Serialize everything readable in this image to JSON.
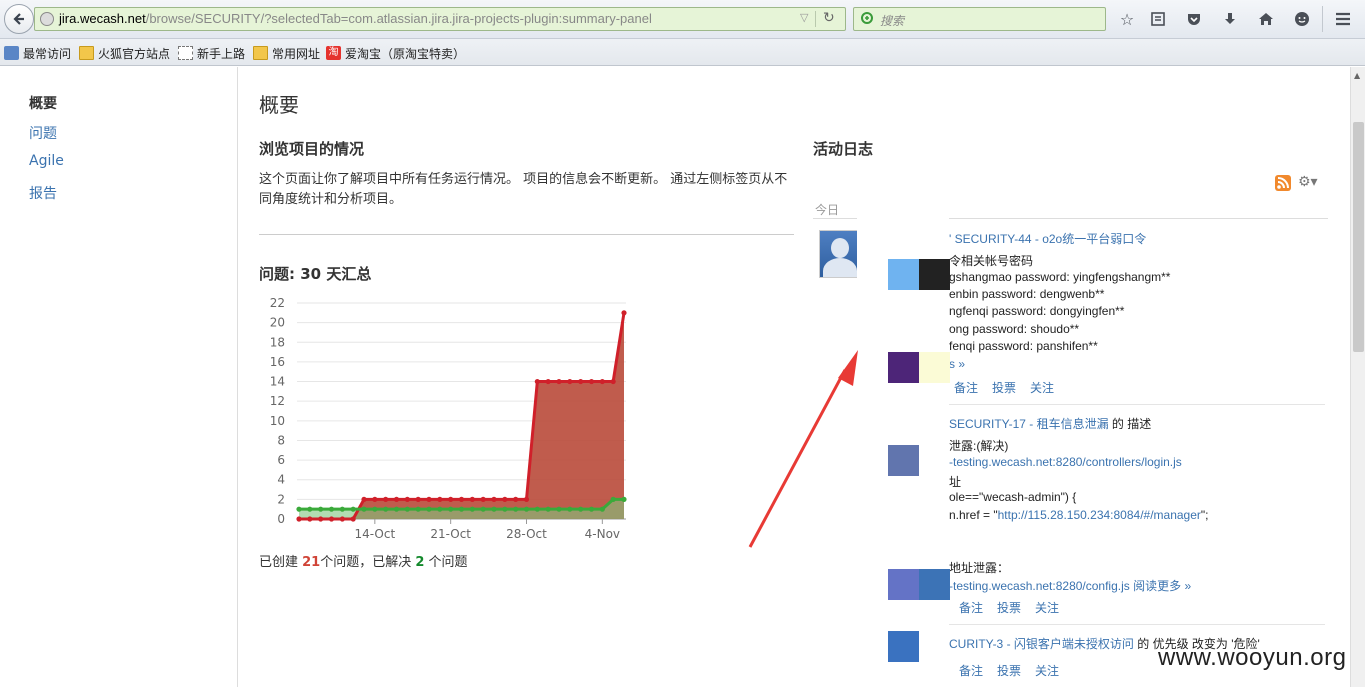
{
  "browser": {
    "url_host": "jira.wecash.net",
    "url_path": "/browse/SECURITY/?selectedTab=com.atlassian.jira.jira-projects-plugin:summary-panel",
    "search_placeholder": "搜索",
    "bookmarks": [
      {
        "label": "最常访问",
        "icon": "gear-icon"
      },
      {
        "label": "火狐官方站点",
        "icon": "folder-icon"
      },
      {
        "label": "新手上路",
        "icon": "page-icon"
      },
      {
        "label": "常用网址",
        "icon": "folder-icon"
      },
      {
        "label": "爱淘宝（原淘宝特卖）",
        "icon": "taobao-icon",
        "icon_text": "淘"
      }
    ]
  },
  "sidebar": {
    "items": [
      {
        "label": "概要",
        "active": true
      },
      {
        "label": "问题",
        "active": false
      },
      {
        "label": "Agile",
        "active": false
      },
      {
        "label": "报告",
        "active": false
      }
    ]
  },
  "main": {
    "title": "概要",
    "overview_title": "浏览项目的情况",
    "overview_desc": "这个页面让你了解项目中所有任务运行情况。 项目的信息会不断更新。 通过左侧标签页从不同角度统计和分析项目。",
    "chart_title": "问题: 30 天汇总",
    "summary": {
      "prefix": "已创建 ",
      "created": "21",
      "mid": "个问题，已解决 ",
      "resolved": "2",
      "suffix": " 个问题"
    }
  },
  "chart_data": {
    "type": "area",
    "title": "问题: 30 天汇总",
    "x_ticks": [
      "14-Oct",
      "21-Oct",
      "28-Oct",
      "4-Nov"
    ],
    "x_tick_index": [
      7,
      14,
      21,
      28
    ],
    "ylim": [
      0,
      22
    ],
    "y_ticks": [
      0,
      2,
      4,
      6,
      8,
      10,
      12,
      14,
      16,
      18,
      20,
      22
    ],
    "grid": true,
    "series": [
      {
        "name": "已创建",
        "color": "#d04437",
        "values": [
          0,
          0,
          0,
          0,
          0,
          0,
          2,
          2,
          2,
          2,
          2,
          2,
          2,
          2,
          2,
          2,
          2,
          2,
          2,
          2,
          2,
          2,
          14,
          14,
          14,
          14,
          14,
          14,
          14,
          14,
          21
        ]
      },
      {
        "name": "已解决",
        "color": "#14892c",
        "values": [
          1,
          1,
          1,
          1,
          1,
          1,
          1,
          1,
          1,
          1,
          1,
          1,
          1,
          1,
          1,
          1,
          1,
          1,
          1,
          1,
          1,
          1,
          1,
          1,
          1,
          1,
          1,
          1,
          1,
          2,
          2
        ]
      }
    ]
  },
  "activity": {
    "title": "活动日志",
    "today_label": "今日",
    "entries": [
      {
        "title": "' SECURITY-44 - o2o统一平台弱口令",
        "lines": [
          "令相关帐号密码",
          "gshangmao password: yingfengshangm**",
          "enbin password: dengwenb**",
          "ngfenqi password: dongyingfen**",
          "ong password: shoudo**",
          "fenqi password: panshifen**"
        ],
        "more": "s »",
        "actions": [
          "备注",
          "投票",
          "关注"
        ]
      },
      {
        "title_link": "SECURITY-17 - 租车信息泄漏",
        "title_suffix": " 的 描述",
        "lines": [
          "泄露:(解决)",
          "-testing.wecash.net:8280/controllers/login.js",
          "址",
          "ole==\"wecash-admin\") {"
        ],
        "href_prefix": "n.href = \"",
        "href_link": "http://115.28.150.234:8084/#/manager",
        "href_suffix": "\";",
        "lines2": [
          "地址泄露：",
          "-testing.wecash.net:8280/config.js"
        ],
        "more": "阅读更多 »",
        "actions": [
          "备注",
          "投票",
          "关注"
        ]
      },
      {
        "title_link": "CURITY-3 - 闪银客户端未授权访问",
        "title_suffix": " 的 优先级 改变为 '危险'",
        "actions": [
          "备注",
          "投票",
          "关注"
        ]
      }
    ]
  },
  "watermark": "www.wooyun.org",
  "colors": {
    "link": "#3b73af",
    "created": "#d04437",
    "resolved": "#14892c",
    "arrow": "#e83a35"
  }
}
